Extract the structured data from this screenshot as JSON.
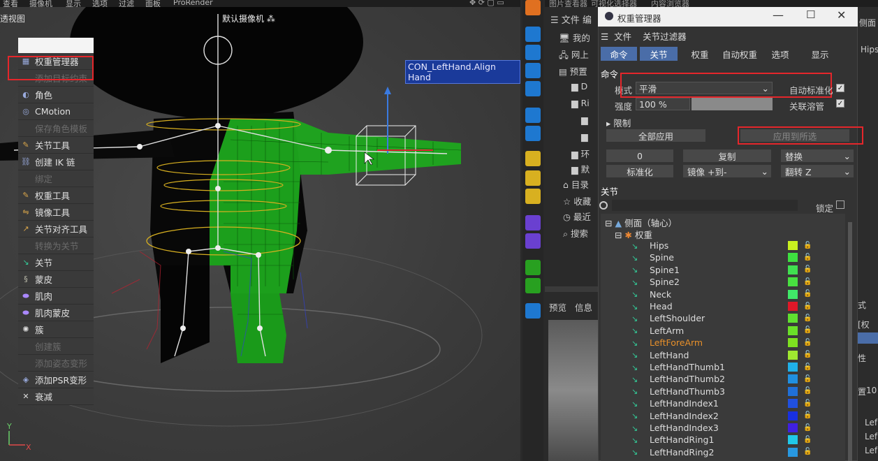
{
  "viewport": {
    "top_menu": [
      "查看",
      "摄像机",
      "显示",
      "选项",
      "过滤",
      "面板",
      "ProRender"
    ],
    "view_label": "透视图",
    "camera_label": "默认摄像机",
    "tooltip": "CON_LeftHand.Align Hand",
    "axis_y": "Y",
    "axis_x": "X"
  },
  "popup_menu": {
    "items": [
      {
        "label": "权重管理器",
        "icon": "weight-manager-icon",
        "disabled": false
      },
      {
        "label": "添加目标约束",
        "icon": "",
        "disabled": true
      },
      {
        "label": "角色",
        "icon": "character-icon",
        "disabled": false
      },
      {
        "label": "CMotion",
        "icon": "cmotion-icon",
        "disabled": false
      },
      {
        "label": "保存角色模板",
        "icon": "",
        "disabled": true
      },
      {
        "label": "关节工具",
        "icon": "joint-tool-icon",
        "disabled": false
      },
      {
        "label": "创建 IK 链",
        "icon": "ik-chain-icon",
        "disabled": false
      },
      {
        "label": "绑定",
        "icon": "",
        "disabled": true
      },
      {
        "label": "权重工具",
        "icon": "weight-tool-icon",
        "disabled": false
      },
      {
        "label": "镜像工具",
        "icon": "mirror-tool-icon",
        "disabled": false
      },
      {
        "label": "关节对齐工具",
        "icon": "joint-align-icon",
        "disabled": false
      },
      {
        "label": "转换为关节",
        "icon": "",
        "disabled": true
      },
      {
        "label": "关节",
        "icon": "joint-icon",
        "disabled": false
      },
      {
        "label": "蒙皮",
        "icon": "skin-icon",
        "disabled": false
      },
      {
        "label": "肌肉",
        "icon": "muscle-icon",
        "disabled": false
      },
      {
        "label": "肌肉蒙皮",
        "icon": "muscle-skin-icon",
        "disabled": false
      },
      {
        "label": "簇",
        "icon": "cluster-icon",
        "disabled": false
      },
      {
        "label": "创建簇",
        "icon": "",
        "disabled": true
      },
      {
        "label": "添加姿态变形",
        "icon": "",
        "disabled": true
      },
      {
        "label": "添加PSR变形",
        "icon": "psr-icon",
        "disabled": false
      },
      {
        "label": "衰减",
        "icon": "falloff-icon",
        "disabled": false
      }
    ]
  },
  "object_manager": {
    "header_tabs": [
      "图片查看器",
      "可视化选择器",
      "内容浏览器"
    ],
    "menu": [
      "文件",
      "编"
    ],
    "tree": [
      "我的",
      "网上",
      "预置",
      "D",
      "Ri",
      "",
      "环",
      "默",
      "目录",
      "收藏",
      "最近",
      "搜索"
    ],
    "preview_tabs": [
      "预览",
      "信息"
    ]
  },
  "weight_manager": {
    "title": "权重管理器",
    "menu": [
      "文件",
      "关节过滤器"
    ],
    "tabs": [
      {
        "label": "命令",
        "active": true
      },
      {
        "label": "关节",
        "active": true
      },
      {
        "label": "权重",
        "active": false
      },
      {
        "label": "自动权重",
        "active": false
      },
      {
        "label": "选项",
        "active": false
      },
      {
        "label": "显示",
        "active": false
      }
    ],
    "section_command": "命令",
    "mode_label": "模式",
    "mode_value": "平滑",
    "auto_normalize": "自动标准化",
    "strength_label": "强度",
    "strength_value": "100 %",
    "link_lock": "关联溶管",
    "limit_label": "限制",
    "apply_all": "全部应用",
    "apply_selected": "应用到所选",
    "zero": "0",
    "copy": "复制",
    "replace": "替换",
    "normalize": "标准化",
    "mirror": "镜像 +到-",
    "flip": "翻转 Z",
    "section_joints": "关节",
    "lock_label": "锁定",
    "tree_root": "侧面（轴心）",
    "tree_weight": "权重",
    "joints": [
      {
        "name": "Hips",
        "color": "#c8f020",
        "highlight": false
      },
      {
        "name": "Spine",
        "color": "#3ee040",
        "highlight": false
      },
      {
        "name": "Spine1",
        "color": "#40e050",
        "highlight": false
      },
      {
        "name": "Spine2",
        "color": "#48e040",
        "highlight": false
      },
      {
        "name": "Neck",
        "color": "#40e868",
        "highlight": false
      },
      {
        "name": "Head",
        "color": "#e01828",
        "highlight": false
      },
      {
        "name": "LeftShoulder",
        "color": "#60e030",
        "highlight": false
      },
      {
        "name": "LeftArm",
        "color": "#6ae028",
        "highlight": false
      },
      {
        "name": "LeftForeArm",
        "color": "#7ee020",
        "highlight": true
      },
      {
        "name": "LeftHand",
        "color": "#a0e830",
        "highlight": false
      },
      {
        "name": "LeftHandThumb1",
        "color": "#20b0e8",
        "highlight": false
      },
      {
        "name": "LeftHandThumb2",
        "color": "#2090e0",
        "highlight": false
      },
      {
        "name": "LeftHandThumb3",
        "color": "#2070d8",
        "highlight": false
      },
      {
        "name": "LeftHandIndex1",
        "color": "#2050e0",
        "highlight": false
      },
      {
        "name": "LeftHandIndex2",
        "color": "#1830e0",
        "highlight": false
      },
      {
        "name": "LeftHandIndex3",
        "color": "#4020e0",
        "highlight": false
      },
      {
        "name": "LeftHandRing1",
        "color": "#20c8e8",
        "highlight": false
      },
      {
        "name": "LeftHandRing2",
        "color": "#2898e0",
        "highlight": false
      }
    ]
  },
  "attr_panel": {
    "items": [
      "侧面",
      "Hips",
      "式",
      "[权",
      "",
      "性",
      "置",
      "10",
      "Lef",
      "Lef",
      "Lef"
    ]
  }
}
